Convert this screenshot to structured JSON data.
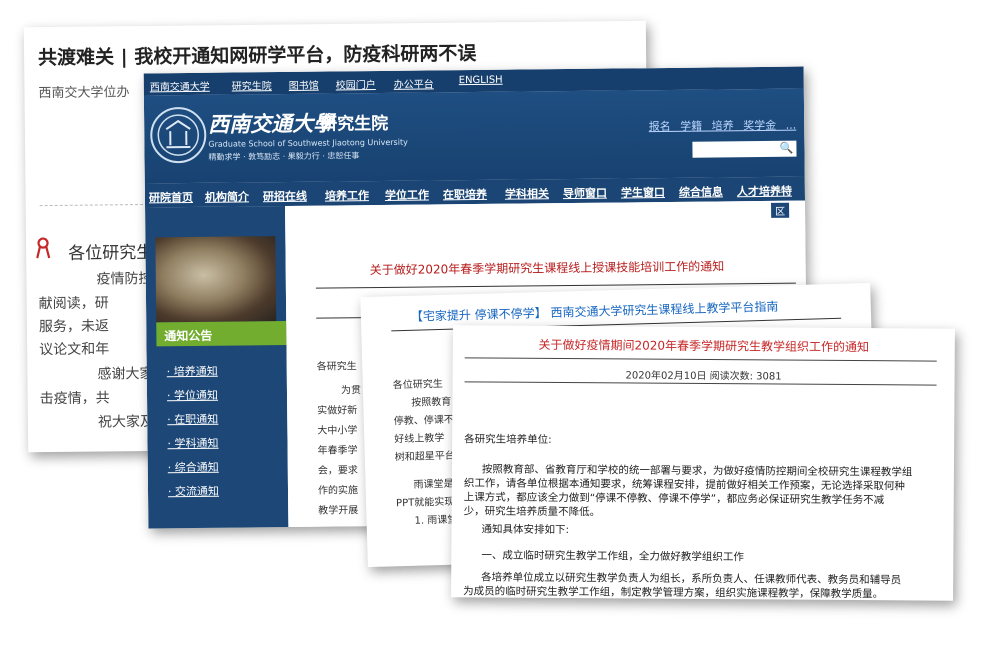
{
  "back": {
    "title": "共渡难关 | 我校开通知网研学平台，防疫科研两不误",
    "source": "西南交大学位办",
    "heading": "各位研究生",
    "lines": [
      "疫情防控",
      "献阅读，研",
      "服务，未返",
      "议论文和年",
      "感谢大家",
      "击疫情，共",
      "祝大家及"
    ]
  },
  "site": {
    "topnav": [
      "西南交通大学",
      "研究生院",
      "图书馆",
      "校园门户",
      "办公平台",
      "ENGLISH"
    ],
    "uni_name": "西南交通大學",
    "yjs": "研究生院",
    "en_name": "Graduate School of Southwest Jiaotong University",
    "motto": "精勤求学 · 敦笃励志 · 果毅力行 · 忠恕任事",
    "quicklinks": "报名 学籍 培养 奖学金 ...",
    "mainnav": [
      "研院首页",
      "机构简介",
      "研招在线",
      "培养工作",
      "学位工作",
      "在职培养",
      "学科相关",
      "导师窗口",
      "学生窗口",
      "综合信息",
      "人才培养特"
    ],
    "notice_tab": "通知公告",
    "sidelinks": [
      "· 培养通知",
      "· 学位通知",
      "· 在职通知",
      "· 学科通知",
      "· 综合通知",
      "· 交流通知"
    ],
    "content_tag": "区",
    "article_title": "关于做好2020年春季学期研究生课程线上授课技能培训工作的通知",
    "fragments": [
      "各研究生",
      "为贯",
      "实做好新",
      "大中小学",
      "年春季学",
      "会，要求",
      "作的实施",
      "教学开展"
    ]
  },
  "wx": {
    "title": "【宅家提升 停课不停学】 西南交通大学研究生课程线上教学平台指南",
    "fragments": [
      "各位研究生",
      "按照教育",
      "停教、停课不",
      "好线上教学",
      "树和超星平台",
      "雨课堂是",
      "PPT就能实现",
      "1. 雨课堂"
    ]
  },
  "front": {
    "title": "关于做好疫情期间2020年春季学期研究生教学组织工作的通知",
    "meta": "2020年02月10日  阅读次数: 3081",
    "salutation": "各研究生培养单位:",
    "p1": [
      "按照教育部、省教育厅和学校的统一部署与要求，为做好疫情防控期间全校研究生课程教学组",
      "织工作，请各单位根据本通知要求，统筹课程安排，提前做好相关工作预案，无论选择采取何种",
      "上课方式，都应该全力做到“停课不停教、停课不停学”，都应务必保证研究生教学任务不减",
      "少，研究生培养质量不降低。"
    ],
    "intro": "通知具体安排如下:",
    "section1": "一、成立临时研究生教学工作组，全力做好教学组织工作",
    "p2": [
      "各培养单位成立以研究生教学负责人为组长，系所负责人、任课教师代表、教务员和辅导员",
      "为成员的临时研究生教学工作组，制定教学管理方案，组织实施课程教学，保障教学质量。"
    ]
  }
}
